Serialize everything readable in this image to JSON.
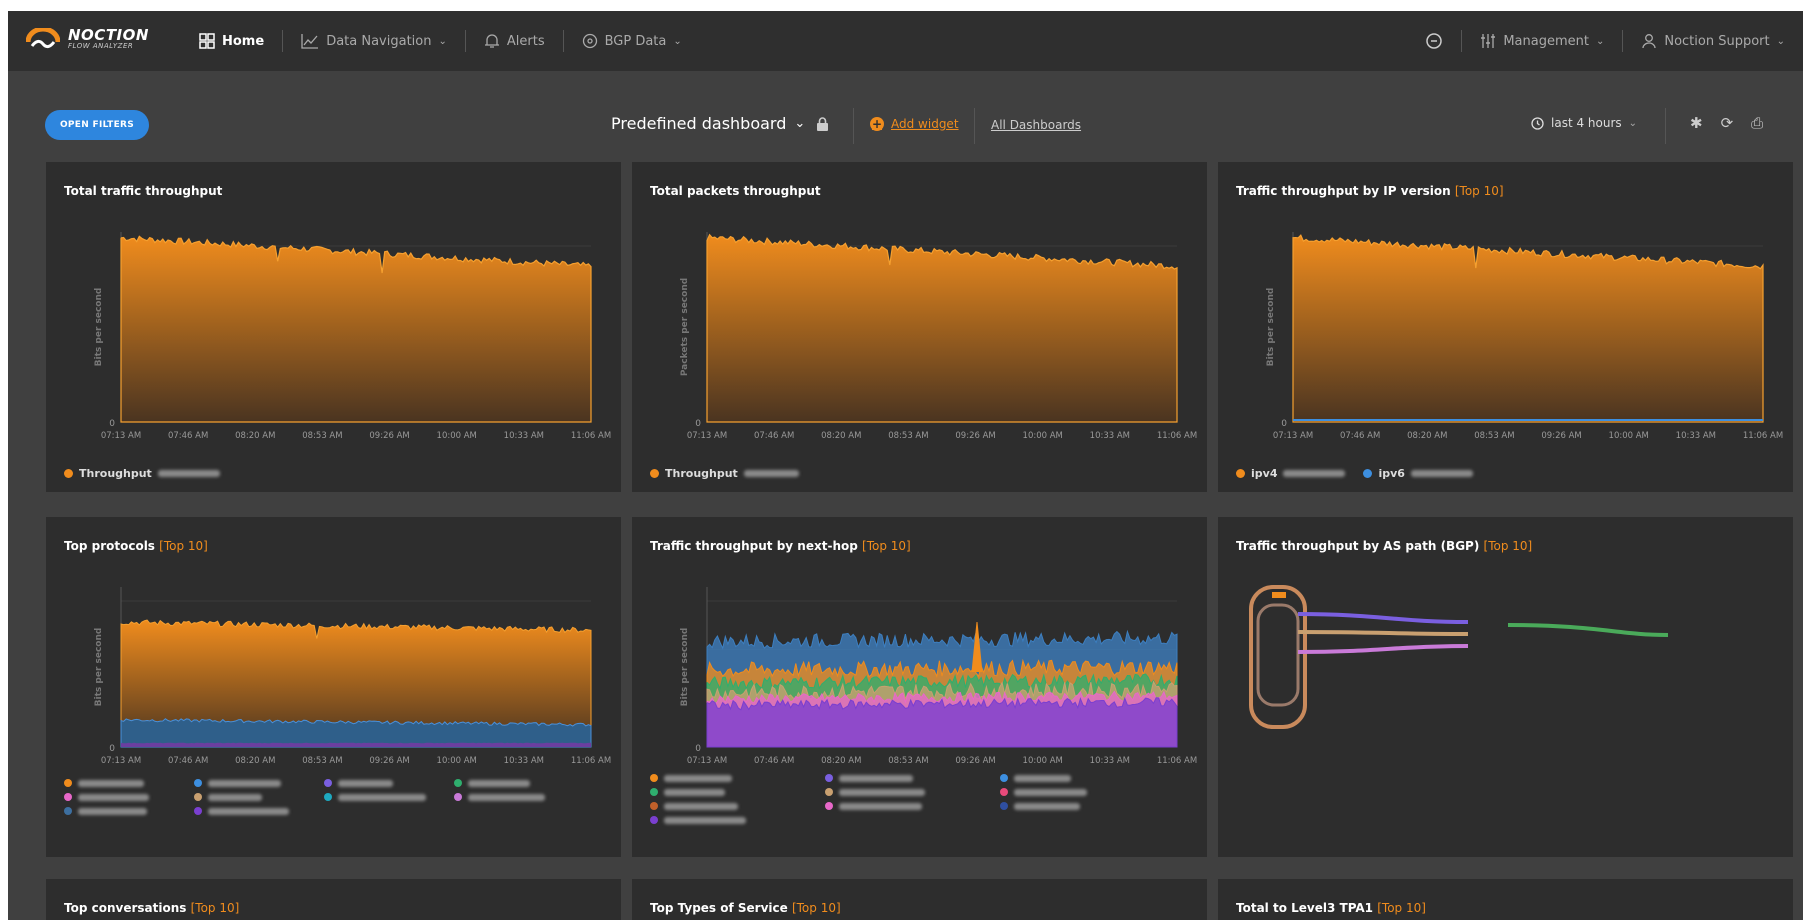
{
  "nav": {
    "logo_main": "NOCTION",
    "logo_sub": "FLOW ANALYZER",
    "items": [
      {
        "label": "Home",
        "icon": "grid-icon"
      },
      {
        "label": "Data Navigation",
        "icon": "chart-line-icon"
      },
      {
        "label": "Alerts",
        "icon": "bell-icon"
      },
      {
        "label": "BGP Data",
        "icon": "globe-icon"
      }
    ],
    "management": "Management",
    "user": "Noction Support"
  },
  "toolbar": {
    "open_filters": "OPEN FILTERS",
    "dashboard": "Predefined dashboard",
    "add_widget": "Add widget",
    "all_dashboards": "All Dashboards",
    "range": "last 4 hours"
  },
  "colors": {
    "accent": "#f08c1d",
    "primary_button": "#2e86de",
    "ipv6_line": "#3d8fe0"
  },
  "time_ticks": [
    "07:13 AM",
    "07:46 AM",
    "08:20 AM",
    "08:53 AM",
    "09:26 AM",
    "10:00 AM",
    "10:33 AM",
    "11:06 AM"
  ],
  "panels": [
    {
      "title": "Total traffic throughput",
      "tag": "",
      "ylabel": "Bits per second",
      "zero": "0",
      "legend": [
        "Throughput"
      ]
    },
    {
      "title": "Total packets throughput",
      "tag": "",
      "ylabel": "Packets per second",
      "zero": "0",
      "legend": [
        "Throughput"
      ]
    },
    {
      "title": "Traffic throughput by IP version",
      "tag": "[Top 10]",
      "ylabel": "Bits per second",
      "zero": "0",
      "legend": [
        "ipv4",
        "ipv6"
      ]
    },
    {
      "title": "Top protocols",
      "tag": "[Top 10]",
      "ylabel": "Bits per second",
      "zero": "0"
    },
    {
      "title": "Traffic throughput by next-hop",
      "tag": "[Top 10]",
      "ylabel": "Bits per second",
      "zero": "0"
    },
    {
      "title": "Traffic throughput by AS path (BGP)",
      "tag": "[Top 10]"
    },
    {
      "title": "Top conversations",
      "tag": "[Top 10]"
    },
    {
      "title": "Top Types of Service",
      "tag": "[Top 10]"
    },
    {
      "title": "Total to Level3 TPA1",
      "tag": "[Top 10]"
    }
  ]
}
